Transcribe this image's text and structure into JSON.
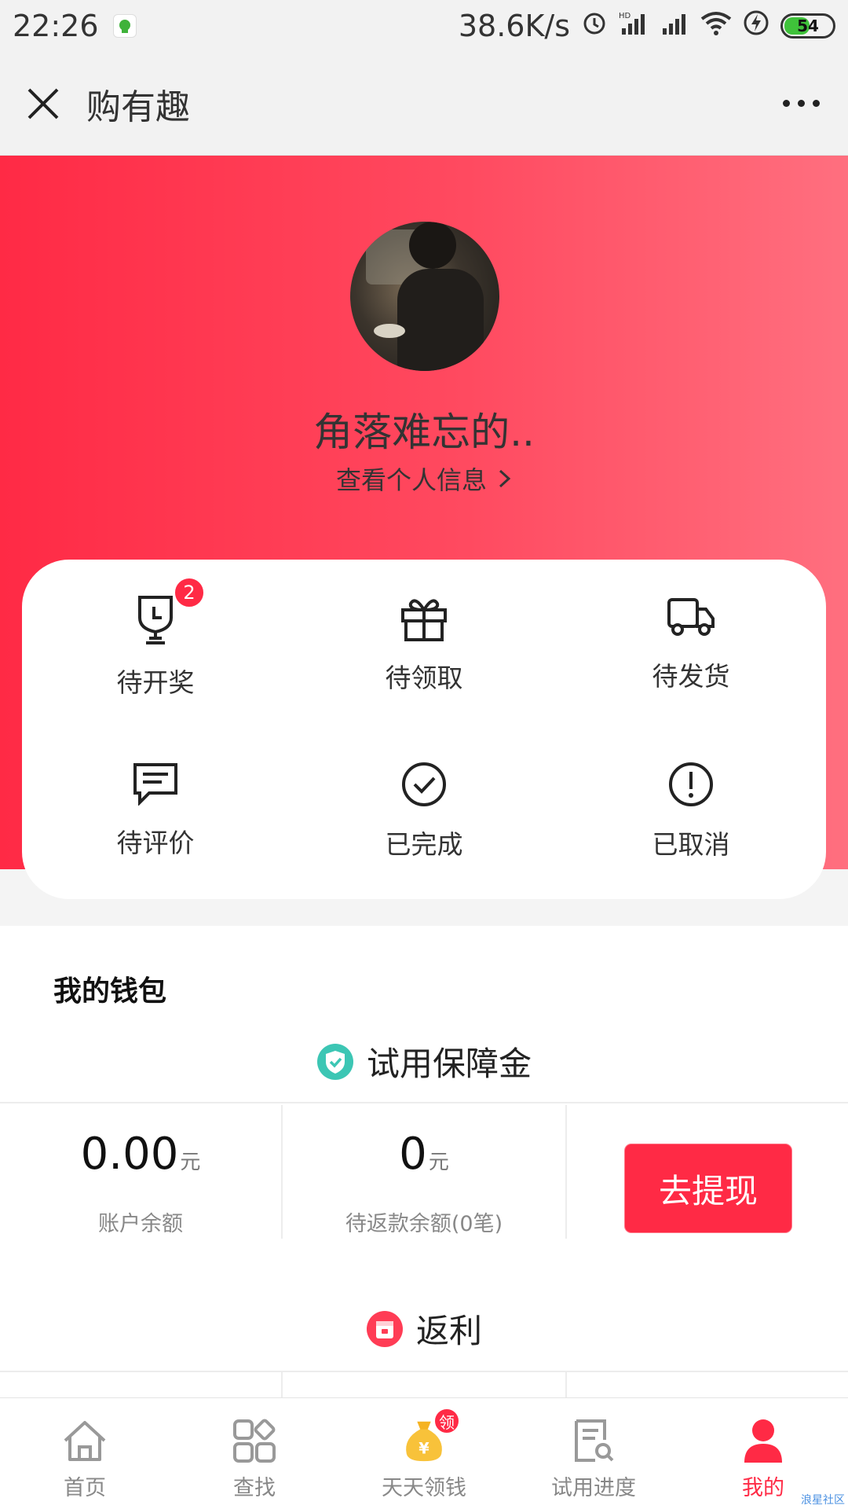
{
  "status_bar": {
    "time": "22:26",
    "network_speed": "38.6K/s",
    "battery": "54",
    "icons": [
      "app-icon",
      "alarm-icon",
      "hd-signal-icon",
      "signal-icon",
      "wifi-icon",
      "charging-icon",
      "battery-icon"
    ]
  },
  "title_bar": {
    "title": "购有趣",
    "close_icon": "close-icon",
    "more_icon": "more-icon"
  },
  "profile": {
    "username": "角落难忘的..",
    "view_profile": "查看个人信息"
  },
  "orders": [
    {
      "label": "待开奖",
      "icon": "trophy-clock-icon",
      "badge": "2"
    },
    {
      "label": "待领取",
      "icon": "gift-icon"
    },
    {
      "label": "待发货",
      "icon": "truck-icon"
    },
    {
      "label": "待评价",
      "icon": "comment-icon"
    },
    {
      "label": "已完成",
      "icon": "check-circle-icon"
    },
    {
      "label": "已取消",
      "icon": "exclamation-circle-icon"
    }
  ],
  "wallet": {
    "title": "我的钱包",
    "section1": "试用保障金",
    "section2": "返利",
    "account_balance": {
      "value": "0.00",
      "unit": "元",
      "label": "账户余额"
    },
    "pending_refund": {
      "value": "0",
      "unit": "元",
      "label": "待返款余额(0笔)"
    },
    "withdraw_label": "去提现"
  },
  "bottom_nav": [
    {
      "label": "首页",
      "icon": "home-icon"
    },
    {
      "label": "查找",
      "icon": "apps-icon"
    },
    {
      "label": "天天领钱",
      "icon": "money-bag-icon",
      "badge": "领"
    },
    {
      "label": "试用进度",
      "icon": "document-search-icon"
    },
    {
      "label": "我的",
      "icon": "user-icon",
      "active": true
    }
  ],
  "watermark": "浪星社区",
  "colors": {
    "accent": "#ff2a45",
    "accent_light": "#ff6f7f"
  }
}
